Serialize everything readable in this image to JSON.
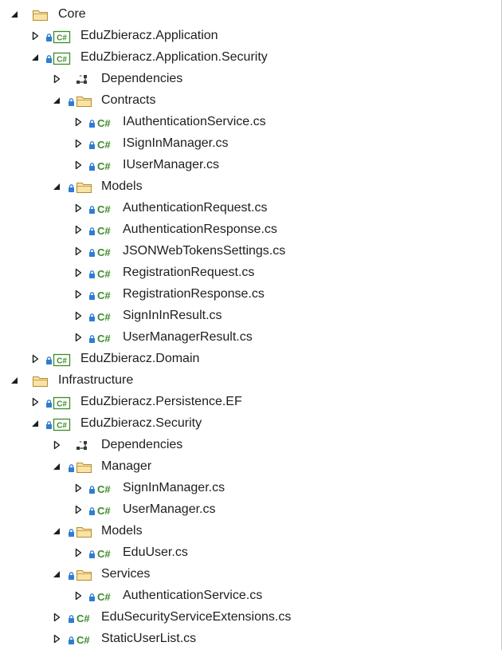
{
  "tree": [
    {
      "level": 0,
      "expand": "expanded",
      "icon": "folder",
      "label": "Core"
    },
    {
      "level": 1,
      "expand": "collapsed",
      "icon": "csproj",
      "label": "EduZbieracz.Application"
    },
    {
      "level": 1,
      "expand": "expanded",
      "icon": "csproj",
      "label": "EduZbieracz.Application.Security"
    },
    {
      "level": 2,
      "expand": "collapsed",
      "icon": "dependencies",
      "label": "Dependencies"
    },
    {
      "level": 2,
      "expand": "expanded",
      "icon": "folder-locked",
      "label": "Contracts"
    },
    {
      "level": 3,
      "expand": "collapsed",
      "icon": "csfile",
      "label": "IAuthenticationService.cs"
    },
    {
      "level": 3,
      "expand": "collapsed",
      "icon": "csfile",
      "label": "ISignInManager.cs"
    },
    {
      "level": 3,
      "expand": "collapsed",
      "icon": "csfile",
      "label": "IUserManager.cs"
    },
    {
      "level": 2,
      "expand": "expanded",
      "icon": "folder-locked",
      "label": "Models"
    },
    {
      "level": 3,
      "expand": "collapsed",
      "icon": "csfile",
      "label": "AuthenticationRequest.cs"
    },
    {
      "level": 3,
      "expand": "collapsed",
      "icon": "csfile",
      "label": "AuthenticationResponse.cs"
    },
    {
      "level": 3,
      "expand": "collapsed",
      "icon": "csfile",
      "label": "JSONWebTokensSettings.cs"
    },
    {
      "level": 3,
      "expand": "collapsed",
      "icon": "csfile",
      "label": "RegistrationRequest.cs"
    },
    {
      "level": 3,
      "expand": "collapsed",
      "icon": "csfile",
      "label": "RegistrationResponse.cs"
    },
    {
      "level": 3,
      "expand": "collapsed",
      "icon": "csfile",
      "label": "SignInInResult.cs"
    },
    {
      "level": 3,
      "expand": "collapsed",
      "icon": "csfile",
      "label": "UserManagerResult.cs"
    },
    {
      "level": 1,
      "expand": "collapsed",
      "icon": "csproj",
      "label": "EduZbieracz.Domain"
    },
    {
      "level": 0,
      "expand": "expanded",
      "icon": "folder",
      "label": "Infrastructure"
    },
    {
      "level": 1,
      "expand": "collapsed",
      "icon": "csproj",
      "label": "EduZbieracz.Persistence.EF"
    },
    {
      "level": 1,
      "expand": "expanded",
      "icon": "csproj",
      "label": "EduZbieracz.Security"
    },
    {
      "level": 2,
      "expand": "collapsed",
      "icon": "dependencies",
      "label": "Dependencies"
    },
    {
      "level": 2,
      "expand": "expanded",
      "icon": "folder-locked",
      "label": "Manager"
    },
    {
      "level": 3,
      "expand": "collapsed",
      "icon": "csfile",
      "label": "SignInManager.cs"
    },
    {
      "level": 3,
      "expand": "collapsed",
      "icon": "csfile",
      "label": "UserManager.cs"
    },
    {
      "level": 2,
      "expand": "expanded",
      "icon": "folder-locked",
      "label": "Models"
    },
    {
      "level": 3,
      "expand": "collapsed",
      "icon": "csfile",
      "label": "EduUser.cs"
    },
    {
      "level": 2,
      "expand": "expanded",
      "icon": "folder-locked",
      "label": "Services"
    },
    {
      "level": 3,
      "expand": "collapsed",
      "icon": "csfile",
      "label": "AuthenticationService.cs"
    },
    {
      "level": 2,
      "expand": "collapsed",
      "icon": "csfile",
      "label": "EduSecurityServiceExtensions.cs"
    },
    {
      "level": 2,
      "expand": "collapsed",
      "icon": "csfile",
      "label": "StaticUserList.cs"
    }
  ],
  "colors": {
    "folder_fill": "#f8e3a6",
    "folder_stroke": "#b68b2f",
    "lock": "#2f7dd1",
    "csharp_green": "#3c8c2a",
    "text": "#1e1e1e",
    "expander": "#1e1e1e"
  }
}
